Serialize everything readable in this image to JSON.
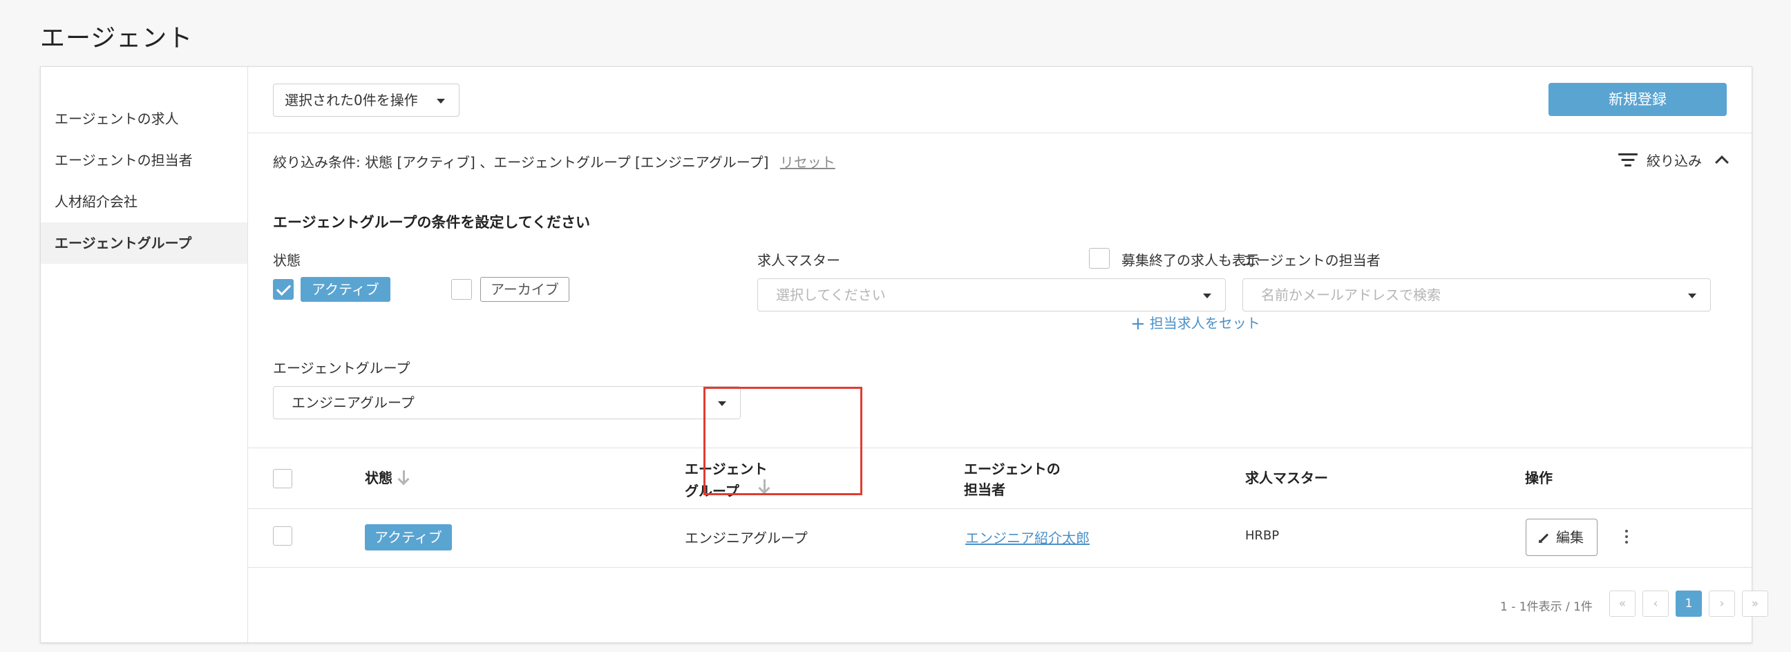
{
  "page_title": "エージェント",
  "sidebar": {
    "items": [
      {
        "label": "エージェントの求人",
        "active": false
      },
      {
        "label": "エージェントの担当者",
        "active": false
      },
      {
        "label": "人材紹介会社",
        "active": false
      },
      {
        "label": "エージェントグループ",
        "active": true
      }
    ]
  },
  "toolbar": {
    "bulk_action_label": "選択された0件を操作",
    "new_button_label": "新規登録"
  },
  "filter_summary": {
    "text": "絞り込み条件:  状態 [アクティブ] 、エージェントグループ [エンジニアグループ]",
    "reset_label": "リセット",
    "toggle_label": "絞り込み"
  },
  "filter_panel": {
    "title": "エージェントグループの条件を設定してください",
    "status_label": "状態",
    "status_options": [
      {
        "label": "アクティブ",
        "checked": true
      },
      {
        "label": "アーカイブ",
        "checked": false
      }
    ],
    "job_master_label": "求人マスター",
    "show_closed_label": "募集終了の求人も表示",
    "job_master_placeholder": "選択してください",
    "add_job_link": "担当求人をセット",
    "agent_person_label": "エージェントの担当者",
    "agent_person_placeholder": "名前かメールアドレスで検索",
    "agent_group_label": "エージェントグループ",
    "agent_group_value": "エンジニアグループ"
  },
  "table": {
    "headers": {
      "status": "状態",
      "group_line1": "エージェント",
      "group_line2": "グループ",
      "person_line1": "エージェントの",
      "person_line2": "担当者",
      "job_master": "求人マスター",
      "actions": "操作"
    },
    "rows": [
      {
        "status": "アクティブ",
        "group": "エンジニアグループ",
        "person": "エンジニア紹介太郎",
        "job_master": "HRBP",
        "edit_label": "編集"
      }
    ]
  },
  "pagination": {
    "info": "1 - 1件表示 / 1件",
    "first": "«",
    "prev": "‹",
    "current": "1",
    "next": "›",
    "last": "»"
  },
  "colors": {
    "accent": "#5aa4d2",
    "link": "#4a90c8",
    "highlight": "#e03c31"
  }
}
